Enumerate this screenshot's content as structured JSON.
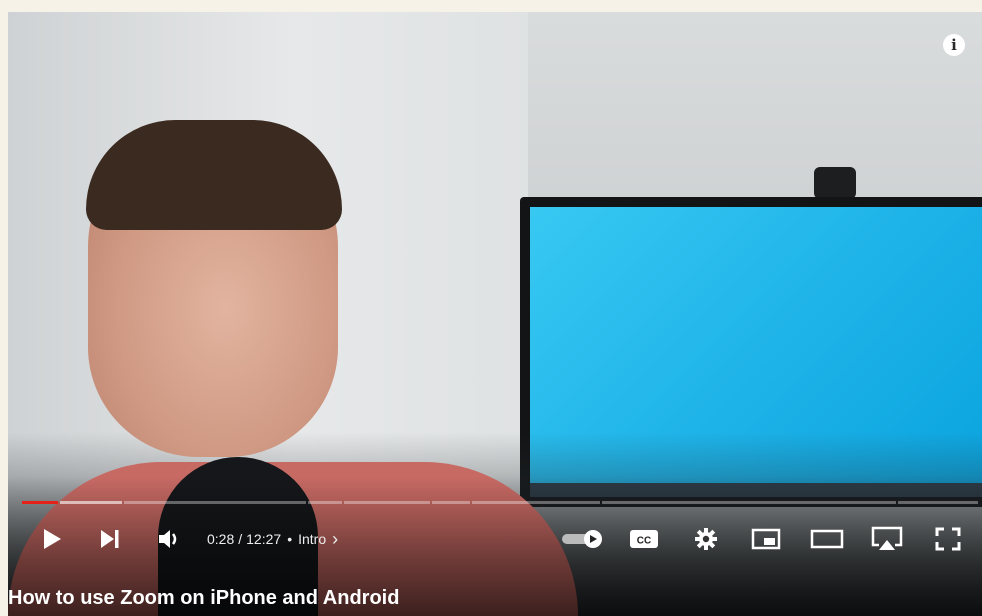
{
  "video": {
    "title": "How to use Zoom on iPhone and Android",
    "current_time": "0:28",
    "duration": "12:27",
    "separator": "/",
    "chapter_dot": "•",
    "chapter": "Intro",
    "chapter_arrow": "›",
    "progress_fraction": 0.038
  },
  "overlay": {
    "info_label": "i"
  },
  "controls": {
    "icons": [
      "play-icon",
      "next-icon",
      "volume-icon",
      "autoplay-toggle-icon",
      "captions-icon",
      "settings-icon",
      "miniplayer-icon",
      "theater-icon",
      "airplay-icon",
      "fullscreen-icon"
    ],
    "cc_label": "CC"
  },
  "colors": {
    "progress_played": "#e62117",
    "page_background": "#f6f2e7"
  }
}
